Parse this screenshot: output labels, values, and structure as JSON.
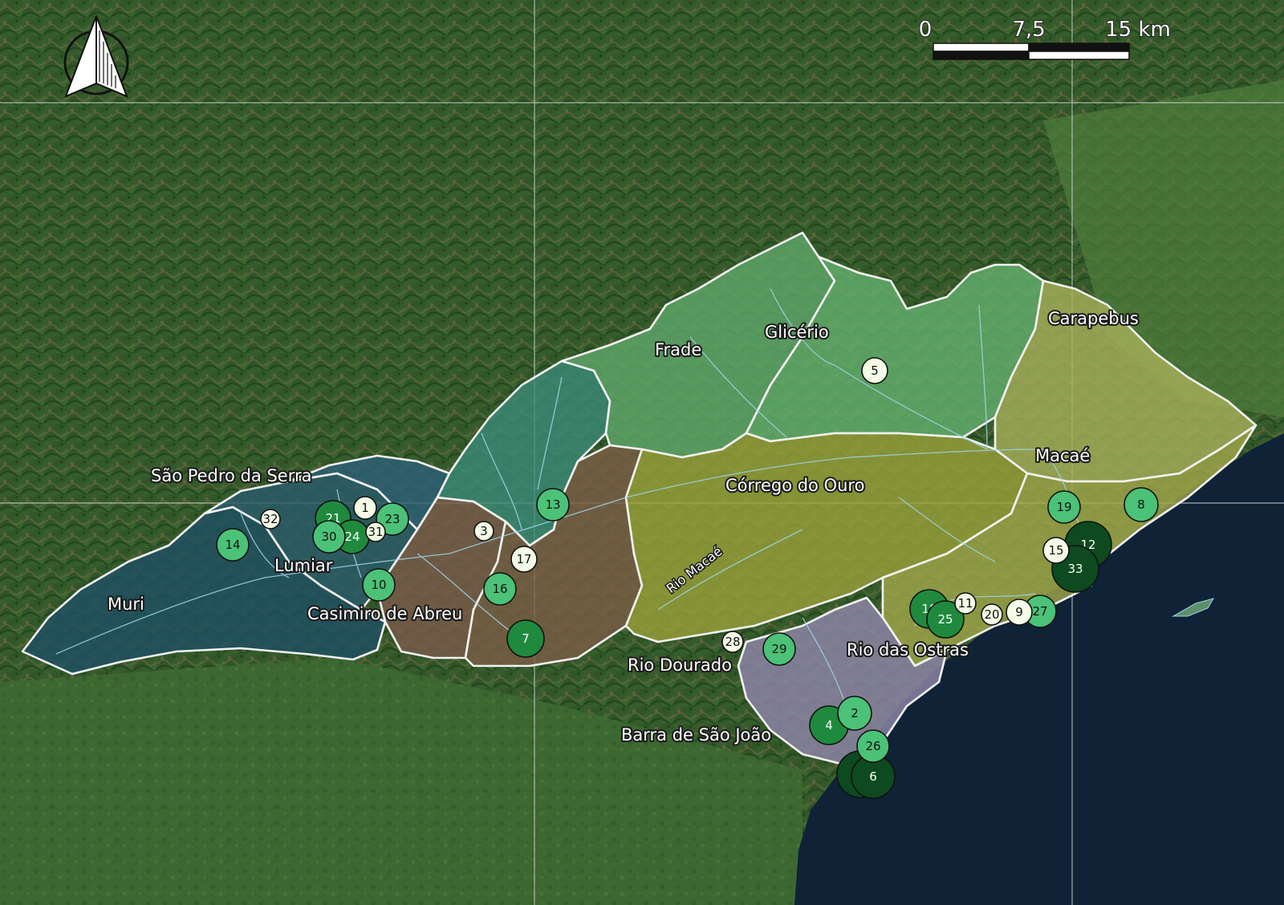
{
  "map": {
    "scale_bar": {
      "labels": [
        "0",
        "7,5",
        "15 km"
      ]
    },
    "north_arrow": {
      "icon": "north-arrow-icon"
    },
    "colors": {
      "ocean": "#0f2236",
      "land_dark": "#2c4a26",
      "land_mid": "#4b6b37",
      "land_brown": "#6b5a3a",
      "boundary": "#f2f2f2",
      "rivers": "#9fd4e8",
      "marker_levels": [
        "#f4fbe6",
        "#a8e6b3",
        "#4bc277",
        "#1f8a3e",
        "#0d4a1f"
      ]
    },
    "regions": [
      {
        "id": "muri",
        "label": "Muri",
        "fill": "#1f4f63"
      },
      {
        "id": "lumiar",
        "label": "Lumiar",
        "fill": "#2a5a6a"
      },
      {
        "id": "sao-pedro",
        "label": "São Pedro da Serra",
        "fill": "#2d5f78"
      },
      {
        "id": "casimiro",
        "label": "Casimiro de Abreu",
        "fill": "#7a5a4a"
      },
      {
        "id": "teal-basin",
        "label": "",
        "fill": "#3a8a78"
      },
      {
        "id": "brown-basin",
        "label": "",
        "fill": "#7a5d45"
      },
      {
        "id": "frade",
        "label": "Frade",
        "fill": "#5fa86a"
      },
      {
        "id": "glicerio",
        "label": "Glicério",
        "fill": "#64b06e"
      },
      {
        "id": "carapebus",
        "label": "Carapebus",
        "fill": "#a8b05a"
      },
      {
        "id": "corrego",
        "label": "Córrego do Ouro",
        "fill": "#9aa03a"
      },
      {
        "id": "macae",
        "label": "Macaé",
        "fill": "#a3a84a"
      },
      {
        "id": "rio-dourado",
        "label": "Rio Dourado",
        "fill": ""
      },
      {
        "id": "rio-ostras",
        "label": "Rio das Ostras",
        "fill": "#8f85a8"
      },
      {
        "id": "barra",
        "label": "Barra de São João",
        "fill": "#6f7e4a"
      }
    ],
    "river_label": "Rio Macaé",
    "sites": [
      {
        "id": "1",
        "label": "1",
        "level": 0
      },
      {
        "id": "2",
        "label": "2",
        "level": 2
      },
      {
        "id": "3",
        "label": "3",
        "level": 0
      },
      {
        "id": "4",
        "label": "4",
        "level": 3
      },
      {
        "id": "5",
        "label": "5",
        "level": 0
      },
      {
        "id": "7",
        "label": "7",
        "level": 3
      },
      {
        "id": "8",
        "label": "8",
        "level": 2
      },
      {
        "id": "9",
        "label": "9",
        "level": 0
      },
      {
        "id": "10",
        "label": "10",
        "level": 2
      },
      {
        "id": "11",
        "label": "11",
        "level": 0
      },
      {
        "id": "12",
        "label": "12",
        "level": 4
      },
      {
        "id": "13",
        "label": "13",
        "level": 2
      },
      {
        "id": "14",
        "label": "14",
        "level": 2
      },
      {
        "id": "15",
        "label": "15",
        "level": 0
      },
      {
        "id": "16",
        "label": "16",
        "level": 2
      },
      {
        "id": "17",
        "label": "17",
        "level": 0
      },
      {
        "id": "18",
        "label": "18",
        "level": 3
      },
      {
        "id": "19",
        "label": "19",
        "level": 2
      },
      {
        "id": "20",
        "label": "20",
        "level": 0
      },
      {
        "id": "21",
        "label": "21",
        "level": 3
      },
      {
        "id": "22",
        "label": "22",
        "level": 4
      },
      {
        "id": "23",
        "label": "23",
        "level": 2
      },
      {
        "id": "24",
        "label": "24",
        "level": 3
      },
      {
        "id": "25",
        "label": "25",
        "level": 3
      },
      {
        "id": "26",
        "label": "26",
        "level": 2
      },
      {
        "id": "6",
        "label": "6",
        "level": 4
      },
      {
        "id": "27",
        "label": "27",
        "level": 2
      },
      {
        "id": "28",
        "label": "28",
        "level": 0
      },
      {
        "id": "29",
        "label": "29",
        "level": 2
      },
      {
        "id": "30",
        "label": "30",
        "level": 2
      },
      {
        "id": "31",
        "label": "31",
        "level": 0
      },
      {
        "id": "32",
        "label": "32",
        "level": 0
      },
      {
        "id": "33",
        "label": "33",
        "level": 4
      }
    ]
  }
}
